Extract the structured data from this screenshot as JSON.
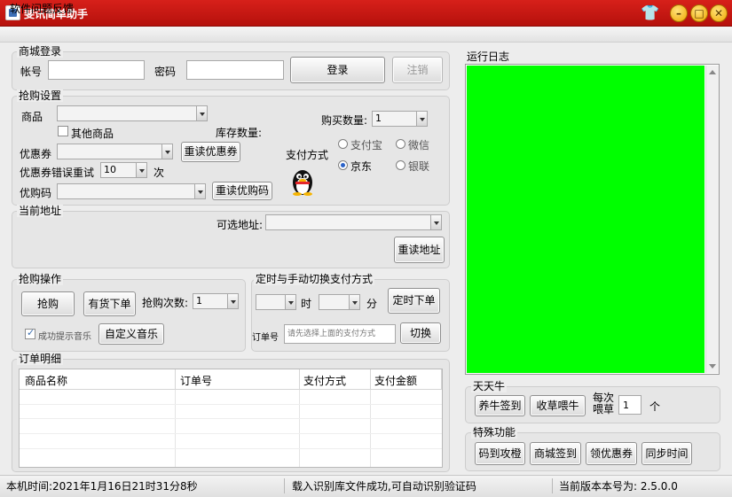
{
  "window": {
    "title": "斐讯简单助手"
  },
  "menu": {
    "items": [
      "软件问题反馈"
    ]
  },
  "login": {
    "group": "商城登录",
    "account_label": "帐号",
    "account_value": "",
    "password_label": "密码",
    "password_value": "",
    "login_button": "登录",
    "logout_button": "注销"
  },
  "buy_settings": {
    "group": "抢购设置",
    "product_label": "商品",
    "product_value": "",
    "other_product_label": "其他商品",
    "other_product_checked": false,
    "stock_label": "库存数量:",
    "qty_label": "购买数量:",
    "qty_value": "1",
    "coupon_label": "优惠券",
    "coupon_value": "",
    "reload_coupon_button": "重读优惠券",
    "retry_label": "优惠券错误重试",
    "retry_value": "10",
    "retry_unit": "次",
    "promo_label": "优购码",
    "promo_value": "",
    "reload_promo_button": "重读优购码",
    "pay_label": "支付方式",
    "pay_options": [
      {
        "label": "支付宝",
        "selected": false
      },
      {
        "label": "微信",
        "selected": false
      },
      {
        "label": "京东",
        "selected": true
      },
      {
        "label": "银联",
        "selected": false
      }
    ]
  },
  "address": {
    "group": "当前地址",
    "optional_label": "可选地址:",
    "optional_value": "",
    "reload_button": "重读地址"
  },
  "operation": {
    "group": "抢购操作",
    "buy_button": "抢购",
    "instock_button": "有货下单",
    "count_label": "抢购次数:",
    "count_value": "1",
    "music_label": "成功提示音乐",
    "music_checked": true,
    "custom_music_button": "自定义音乐"
  },
  "timer": {
    "group": "定时与手动切换支付方式",
    "hour_value": "",
    "hour_label": "时",
    "minute_value": "",
    "minute_label": "分",
    "timed_button": "定时下单",
    "order_label": "订单号",
    "order_placeholder": "请先选择上面的支付方式",
    "switch_button": "切换"
  },
  "orders": {
    "group": "订单明细",
    "columns": [
      "商品名称",
      "订单号",
      "支付方式",
      "支付金额"
    ],
    "rows": []
  },
  "log": {
    "group": "运行日志",
    "color": "#00ff00"
  },
  "tianniu": {
    "group": "天天牛",
    "sign_button": "养牛签到",
    "feed_button": "收草喂牛",
    "per_label_1": "每次",
    "per_label_2": "喂草",
    "per_value": "1",
    "per_unit": "个"
  },
  "special": {
    "group": "特殊功能",
    "buttons": [
      "码到攻橙",
      "商城签到",
      "领优惠券",
      "同步时间"
    ]
  },
  "status": {
    "local_time": "本机时间:2021年1月16日21时31分8秒",
    "message": "载入识别库文件成功,可自动识别验证码",
    "version": "当前版本本号为:  2.5.0.0"
  }
}
